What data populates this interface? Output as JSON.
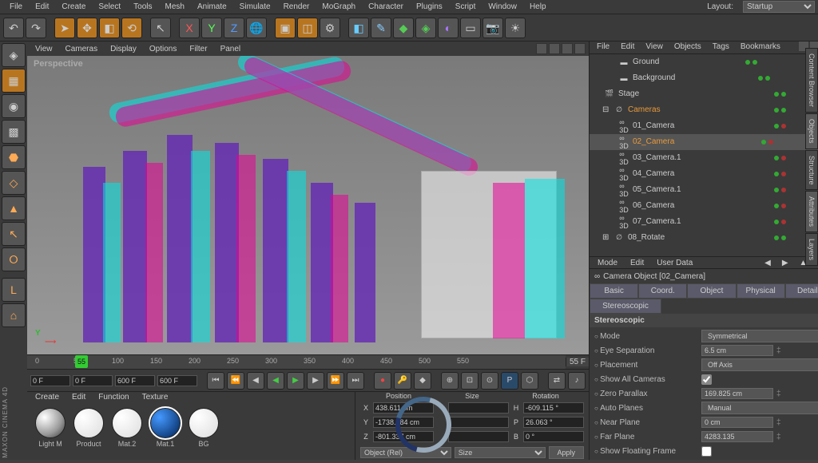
{
  "menubar": {
    "items": [
      "File",
      "Edit",
      "Create",
      "Select",
      "Tools",
      "Mesh",
      "Animate",
      "Simulate",
      "Render",
      "MoGraph",
      "Character",
      "Plugins",
      "Script",
      "Window",
      "Help"
    ],
    "layout_label": "Layout:",
    "layout_value": "Startup"
  },
  "viewport_menu": {
    "items": [
      "View",
      "Cameras",
      "Display",
      "Options",
      "Filter",
      "Panel"
    ],
    "label": "Perspective",
    "axis_y": "Y"
  },
  "timeline": {
    "ticks": [
      "0",
      "50",
      "100",
      "150",
      "200",
      "250",
      "300",
      "350",
      "400",
      "450",
      "500",
      "550"
    ],
    "marker": "55",
    "end_label": "55 F"
  },
  "transport": {
    "start": "0 F",
    "range_from": "0 F",
    "range_to_left": "600 F",
    "range_to_right": "600 F"
  },
  "materials": {
    "menu": [
      "Create",
      "Edit",
      "Function",
      "Texture"
    ],
    "items": [
      {
        "name": "Light M",
        "css": "radial-gradient(circle at 30% 30%, #fff, #999 60%, #333)"
      },
      {
        "name": "Product",
        "css": "radial-gradient(circle at 30% 30%, #fff, #ddd)"
      },
      {
        "name": "Mat.2",
        "css": "radial-gradient(circle at 30% 30%, #fff, #ddd)"
      },
      {
        "name": "Mat.1",
        "css": "radial-gradient(circle at 30% 30%, #49f, #025)"
      },
      {
        "name": "BG",
        "css": "radial-gradient(circle at 30% 30%, #fff, #ddd)"
      }
    ]
  },
  "coords": {
    "headers": [
      "Position",
      "Size",
      "Rotation"
    ],
    "rows": [
      {
        "axis": "X",
        "p": "438.611 cm",
        "s": "",
        "rl": "H",
        "r": "-609.115 °"
      },
      {
        "axis": "Y",
        "p": "-1738.684 cm",
        "s": "",
        "rl": "P",
        "r": "26.063 °"
      },
      {
        "axis": "Z",
        "p": "-801.337 cm",
        "s": "",
        "rl": "B",
        "r": "0 °"
      }
    ],
    "object_mode": "Object (Rel)",
    "size_mode": "Size",
    "apply": "Apply"
  },
  "object_manager": {
    "menu": [
      "File",
      "Edit",
      "View",
      "Objects",
      "Tags",
      "Bookmarks"
    ],
    "tree": [
      {
        "indent": 28,
        "icon": "▬",
        "name": "Ground",
        "dots": [
          "g",
          "g"
        ],
        "extras": [
          "sphere",
          "gear"
        ]
      },
      {
        "indent": 28,
        "icon": "▬",
        "name": "Background",
        "dots": [
          "g",
          "g"
        ],
        "extras": [
          "sphere"
        ]
      },
      {
        "indent": 10,
        "icon": "🎬",
        "name": "Stage",
        "dots": [
          "g",
          "g"
        ]
      },
      {
        "indent": 10,
        "icon": "∅",
        "name": "Cameras",
        "highlight": true,
        "dots": [
          "g",
          "g"
        ],
        "expander": "⊟"
      },
      {
        "indent": 28,
        "icon": "∞",
        "name": "01_Camera",
        "dots": [
          "g",
          "r"
        ],
        "sub": "3D"
      },
      {
        "indent": 28,
        "icon": "∞",
        "name": "02_Camera",
        "sel": true,
        "dots": [
          "g",
          "r"
        ],
        "sub": "3D",
        "extras": [
          "gear"
        ]
      },
      {
        "indent": 28,
        "icon": "∞",
        "name": "03_Camera.1",
        "dots": [
          "g",
          "r"
        ],
        "sub": "3D"
      },
      {
        "indent": 28,
        "icon": "∞",
        "name": "04_Camera",
        "dots": [
          "g",
          "r"
        ],
        "sub": "3D"
      },
      {
        "indent": 28,
        "icon": "∞",
        "name": "05_Camera.1",
        "dots": [
          "g",
          "r"
        ],
        "sub": "3D"
      },
      {
        "indent": 28,
        "icon": "∞",
        "name": "06_Camera",
        "dots": [
          "g",
          "r"
        ],
        "sub": "3D"
      },
      {
        "indent": 28,
        "icon": "∞",
        "name": "07_Camera.1",
        "dots": [
          "g",
          "r"
        ],
        "sub": "3D"
      },
      {
        "indent": 10,
        "icon": "∅",
        "name": "08_Rotate",
        "dots": [
          "g",
          "g"
        ],
        "expander": "⊞"
      }
    ]
  },
  "attributes": {
    "menu": [
      "Mode",
      "Edit",
      "User Data"
    ],
    "title": "Camera Object [02_Camera]",
    "tabs1": [
      "Basic",
      "Coord.",
      "Object",
      "Physical",
      "Details"
    ],
    "tabs2": "Stereoscopic",
    "section": "Stereoscopic",
    "rows": [
      {
        "label": "Mode",
        "type": "select",
        "value": "Symmetrical"
      },
      {
        "label": "Eye Separation",
        "type": "text",
        "value": "6.5 cm"
      },
      {
        "label": "Placement",
        "type": "select",
        "value": "Off Axis"
      },
      {
        "label": "Show All Cameras",
        "type": "check",
        "value": true
      },
      {
        "label": "Zero Parallax",
        "type": "text",
        "value": "169.825 cm"
      },
      {
        "label": "Auto Planes",
        "type": "select",
        "value": "Manual"
      },
      {
        "label": "Near Plane",
        "type": "text",
        "value": "0 cm"
      },
      {
        "label": "Far Plane",
        "type": "text",
        "value": "4283.135"
      },
      {
        "label": "Show Floating Frame",
        "type": "check",
        "value": false
      }
    ]
  },
  "right_tabs": [
    "Content Browser",
    "Objects",
    "Structure",
    "Attributes",
    "Layers"
  ],
  "brand": "MAXON CINEMA 4D"
}
